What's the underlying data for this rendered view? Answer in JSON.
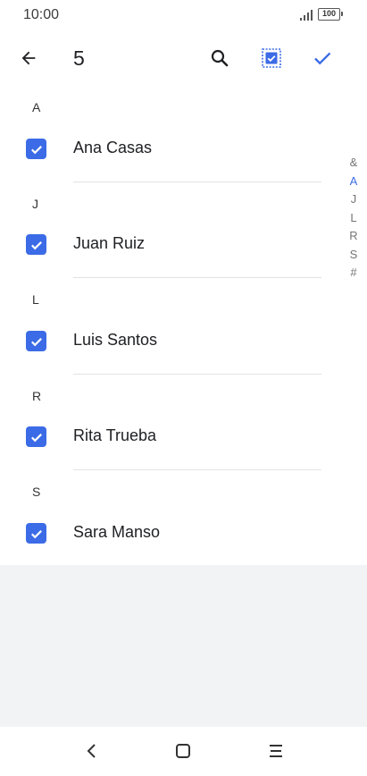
{
  "status": {
    "time": "10:00",
    "battery": "100"
  },
  "header": {
    "selected_count": "5"
  },
  "sections": [
    {
      "letter": "A",
      "contact": "Ana Casas"
    },
    {
      "letter": "J",
      "contact": "Juan Ruiz"
    },
    {
      "letter": "L",
      "contact": "Luis Santos"
    },
    {
      "letter": "R",
      "contact": "Rita Trueba"
    },
    {
      "letter": "S",
      "contact": "Sara Manso"
    }
  ],
  "index": [
    "&",
    "A",
    "J",
    "L",
    "R",
    "S",
    "#"
  ],
  "colors": {
    "accent": "#3b6be6",
    "empty_bg": "#f2f3f4"
  },
  "icons": {
    "back": "arrow-left-icon",
    "search": "search-icon",
    "select_all": "select-all-icon",
    "confirm": "check-icon",
    "nav_back": "nav-back-icon",
    "nav_home": "nav-home-icon",
    "nav_menu": "nav-menu-icon"
  }
}
